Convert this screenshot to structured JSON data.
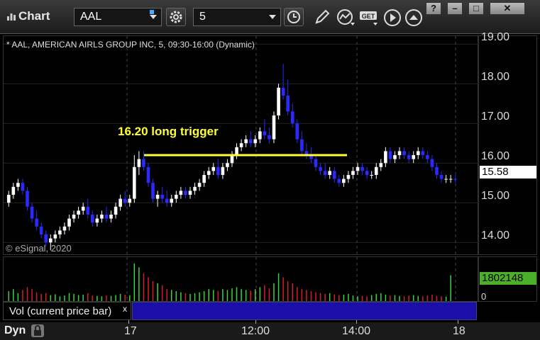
{
  "app": {
    "title": "Chart"
  },
  "toolbar": {
    "symbol_value": "AAL",
    "interval_value": "5"
  },
  "window_buttons": [
    "?",
    "–",
    "□",
    "✕"
  ],
  "chart": {
    "info_text": "* AAL, AMERICAN AIRLS GROUP INC, 5, 09:30-16:00 (Dynamic)",
    "copyright": "© eSignal, 2020",
    "annotation": "16.20 long trigger",
    "last_price": "15.58",
    "price_ticks": [
      "19.00",
      "18.00",
      "17.00",
      "16.00",
      "15.00",
      "14.00"
    ],
    "volume_tag": "1802148",
    "volume_zero": "0",
    "volume_study_label": "Vol (current price bar)",
    "volume_close": "x",
    "time_ticks": [
      "17",
      "12:00",
      "14:00",
      "18"
    ],
    "bottom_label": "Dyn"
  },
  "chart_data": {
    "type": "candlestick",
    "ylim": [
      13.7,
      19.2
    ],
    "trigger_level": 16.2,
    "series": [
      {
        "values": [
          [
            15.0,
            15.3,
            14.9,
            15.2
          ],
          [
            15.2,
            15.5,
            15.1,
            15.4
          ],
          [
            15.4,
            15.6,
            15.3,
            15.5
          ],
          [
            15.5,
            15.6,
            15.2,
            15.3
          ],
          [
            15.3,
            15.4,
            14.8,
            14.9
          ],
          [
            14.9,
            15.0,
            14.5,
            14.6
          ],
          [
            14.6,
            14.8,
            14.3,
            14.4
          ],
          [
            14.4,
            14.5,
            14.1,
            14.2
          ],
          [
            14.2,
            14.3,
            13.9,
            14.0
          ],
          [
            14.0,
            14.2,
            13.8,
            14.1
          ],
          [
            14.1,
            14.3,
            14.0,
            14.2
          ],
          [
            14.2,
            14.4,
            14.1,
            14.3
          ],
          [
            14.3,
            14.5,
            14.2,
            14.4
          ],
          [
            14.4,
            14.7,
            14.3,
            14.6
          ],
          [
            14.6,
            14.8,
            14.5,
            14.7
          ],
          [
            14.7,
            14.9,
            14.6,
            14.8
          ],
          [
            14.8,
            15.0,
            14.7,
            14.9
          ],
          [
            14.9,
            15.1,
            14.6,
            14.7
          ],
          [
            14.7,
            14.8,
            14.4,
            14.5
          ],
          [
            14.5,
            14.7,
            14.4,
            14.6
          ],
          [
            14.6,
            14.8,
            14.5,
            14.7
          ],
          [
            14.7,
            14.9,
            14.5,
            14.6
          ],
          [
            14.6,
            14.8,
            14.5,
            14.7
          ],
          [
            14.7,
            15.0,
            14.6,
            14.9
          ],
          [
            14.9,
            15.2,
            14.8,
            15.1
          ],
          [
            15.1,
            15.3,
            14.9,
            15.0
          ],
          [
            15.0,
            15.2,
            14.9,
            15.1
          ],
          [
            15.1,
            16.2,
            15.0,
            15.9
          ],
          [
            15.9,
            16.3,
            15.7,
            16.1
          ],
          [
            16.1,
            16.3,
            15.8,
            15.9
          ],
          [
            15.9,
            16.0,
            15.4,
            15.5
          ],
          [
            15.5,
            15.6,
            15.0,
            15.1
          ],
          [
            15.1,
            15.3,
            14.9,
            15.2
          ],
          [
            15.2,
            15.4,
            15.0,
            15.1
          ],
          [
            15.1,
            15.3,
            14.9,
            15.0
          ],
          [
            15.0,
            15.2,
            14.9,
            15.1
          ],
          [
            15.1,
            15.3,
            15.0,
            15.2
          ],
          [
            15.2,
            15.4,
            15.1,
            15.3
          ],
          [
            15.3,
            15.4,
            15.1,
            15.2
          ],
          [
            15.2,
            15.4,
            15.1,
            15.3
          ],
          [
            15.3,
            15.5,
            15.2,
            15.4
          ],
          [
            15.4,
            15.6,
            15.3,
            15.5
          ],
          [
            15.5,
            15.8,
            15.4,
            15.7
          ],
          [
            15.7,
            15.9,
            15.6,
            15.8
          ],
          [
            15.8,
            16.0,
            15.7,
            15.9
          ],
          [
            15.9,
            16.1,
            15.6,
            15.7
          ],
          [
            15.7,
            16.0,
            15.6,
            15.9
          ],
          [
            15.9,
            16.1,
            15.8,
            16.0
          ],
          [
            16.0,
            16.3,
            15.9,
            16.2
          ],
          [
            16.2,
            16.5,
            16.1,
            16.4
          ],
          [
            16.4,
            16.6,
            16.3,
            16.5
          ],
          [
            16.5,
            16.7,
            16.4,
            16.6
          ],
          [
            16.6,
            16.8,
            16.4,
            16.5
          ],
          [
            16.5,
            16.7,
            16.4,
            16.6
          ],
          [
            16.6,
            16.9,
            16.5,
            16.8
          ],
          [
            16.8,
            17.1,
            16.6,
            16.7
          ],
          [
            16.7,
            16.9,
            16.5,
            16.6
          ],
          [
            16.6,
            17.3,
            16.5,
            17.2
          ],
          [
            17.2,
            18.0,
            17.1,
            17.9
          ],
          [
            17.9,
            18.5,
            17.6,
            17.7
          ],
          [
            17.7,
            18.1,
            17.2,
            17.3
          ],
          [
            17.3,
            17.5,
            16.9,
            17.0
          ],
          [
            17.0,
            17.1,
            16.5,
            16.6
          ],
          [
            16.6,
            16.8,
            16.2,
            16.3
          ],
          [
            16.3,
            16.5,
            16.1,
            16.2
          ],
          [
            16.2,
            16.4,
            16.0,
            16.1
          ],
          [
            16.1,
            16.2,
            15.8,
            15.9
          ],
          [
            15.9,
            16.0,
            15.7,
            15.8
          ],
          [
            15.8,
            16.0,
            15.6,
            15.7
          ],
          [
            15.7,
            15.9,
            15.6,
            15.8
          ],
          [
            15.8,
            15.9,
            15.5,
            15.6
          ],
          [
            15.6,
            15.7,
            15.4,
            15.5
          ],
          [
            15.5,
            15.7,
            15.4,
            15.6
          ],
          [
            15.6,
            15.8,
            15.5,
            15.7
          ],
          [
            15.7,
            15.9,
            15.6,
            15.8
          ],
          [
            15.8,
            16.0,
            15.7,
            15.9
          ],
          [
            15.9,
            16.0,
            15.7,
            15.8
          ],
          [
            15.8,
            15.9,
            15.6,
            15.7
          ],
          [
            15.7,
            15.8,
            15.6,
            15.7
          ],
          [
            15.7,
            16.0,
            15.6,
            15.9
          ],
          [
            15.9,
            16.1,
            15.8,
            16.0
          ],
          [
            16.0,
            16.4,
            15.9,
            16.3
          ],
          [
            16.3,
            16.4,
            16.0,
            16.1
          ],
          [
            16.1,
            16.3,
            16.0,
            16.2
          ],
          [
            16.2,
            16.4,
            16.1,
            16.3
          ],
          [
            16.3,
            16.4,
            16.1,
            16.2
          ],
          [
            16.2,
            16.3,
            16.0,
            16.1
          ],
          [
            16.1,
            16.3,
            16.0,
            16.2
          ],
          [
            16.2,
            16.4,
            16.1,
            16.3
          ],
          [
            16.3,
            16.4,
            16.1,
            16.2
          ],
          [
            16.2,
            16.3,
            16.0,
            16.1
          ],
          [
            16.1,
            16.2,
            15.8,
            15.9
          ],
          [
            15.9,
            16.0,
            15.6,
            15.7
          ],
          [
            15.7,
            15.8,
            15.5,
            15.6
          ],
          [
            15.6,
            15.7,
            15.5,
            15.6
          ],
          [
            15.6,
            15.7,
            15.5,
            15.6
          ],
          [
            15.6,
            15.7,
            15.5,
            15.58
          ]
        ]
      }
    ],
    "volume": [
      0.25,
      0.3,
      0.2,
      0.28,
      0.35,
      0.3,
      0.22,
      0.18,
      0.2,
      0.15,
      0.17,
      0.12,
      0.14,
      0.2,
      0.18,
      0.15,
      0.16,
      0.2,
      0.14,
      0.13,
      0.12,
      0.14,
      0.13,
      0.15,
      0.18,
      0.16,
      0.14,
      0.95,
      0.85,
      0.7,
      0.6,
      0.5,
      0.45,
      0.4,
      0.3,
      0.28,
      0.25,
      0.22,
      0.2,
      0.18,
      0.2,
      0.22,
      0.25,
      0.3,
      0.28,
      0.26,
      0.3,
      0.28,
      0.32,
      0.35,
      0.3,
      0.28,
      0.26,
      0.3,
      0.35,
      0.4,
      0.32,
      0.45,
      0.7,
      0.6,
      0.5,
      0.45,
      0.35,
      0.3,
      0.28,
      0.25,
      0.22,
      0.2,
      0.18,
      0.2,
      0.17,
      0.15,
      0.16,
      0.18,
      0.14,
      0.12,
      0.13,
      0.12,
      0.15,
      0.18,
      0.2,
      0.16,
      0.14,
      0.15,
      0.13,
      0.12,
      0.14,
      0.15,
      0.13,
      0.12,
      0.14,
      0.16,
      0.13,
      0.12,
      0.11,
      0.65
    ]
  }
}
